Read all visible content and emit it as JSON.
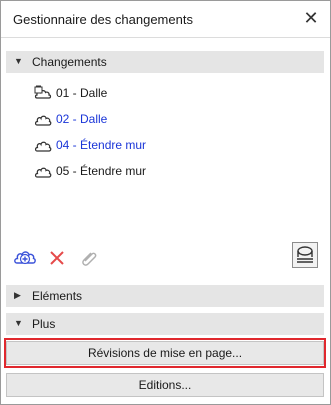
{
  "window": {
    "title": "Gestionnaire des changements",
    "close_glyph": "✕"
  },
  "sections": {
    "changements": {
      "label": "Changements",
      "expanded": true
    },
    "elements": {
      "label": "Eléments",
      "expanded": false
    },
    "plus": {
      "label": "Plus",
      "expanded": true
    }
  },
  "changes": [
    {
      "label": "01 - Dalle",
      "icon": "change-cloud-lock-icon",
      "color": "#1a1a1a"
    },
    {
      "label": "02 - Dalle",
      "icon": "change-cloud-icon",
      "color": "#1a35d8"
    },
    {
      "label": "04 - Étendre mur",
      "icon": "change-cloud-icon",
      "color": "#1a35d8"
    },
    {
      "label": "05 - Étendre mur",
      "icon": "change-cloud-icon",
      "color": "#1a1a1a"
    }
  ],
  "toolbar": {
    "icons": [
      "add-change-icon",
      "delete-icon",
      "link-icon",
      "settings-stack-icon"
    ]
  },
  "buttons": {
    "revisions": "Révisions de mise en page...",
    "editions": "Editions..."
  },
  "colors": {
    "accent_blue": "#1a35d8",
    "delete_red": "#e54a4a",
    "highlight_red": "#e0282e"
  }
}
